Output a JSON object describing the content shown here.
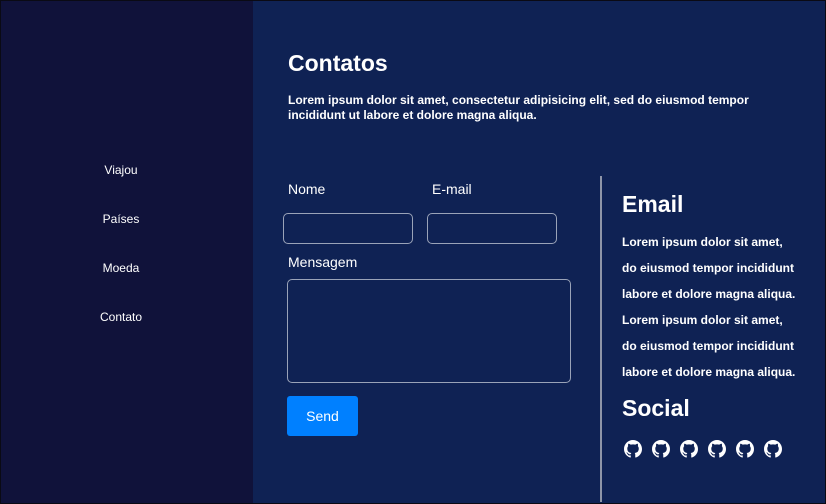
{
  "nav": {
    "items": [
      {
        "label": "Viajou"
      },
      {
        "label": "Países"
      },
      {
        "label": "Moeda"
      },
      {
        "label": "Contato"
      }
    ]
  },
  "header": {
    "title": "Contatos",
    "intro": "Lorem ipsum dolor sit amet, consectetur adipisicing elit, sed do eiusmod tempor incididunt ut labore et dolore magna aliqua."
  },
  "form": {
    "name_label": "Nome",
    "email_label": "E-mail",
    "message_label": "Mensagem",
    "name_value": "",
    "email_value": "",
    "message_value": "",
    "send_label": "Send"
  },
  "contact": {
    "email_heading": "Email",
    "email_lines": [
      "Lorem ipsum dolor sit amet,",
      "do eiusmod tempor incididunt",
      "labore et dolore magna aliqua.",
      "Lorem ipsum dolor sit amet,",
      "do eiusmod tempor incididunt",
      "labore et dolore magna aliqua."
    ],
    "social_heading": "Social",
    "social_icons": [
      "github-icon",
      "github-icon",
      "github-icon",
      "github-icon",
      "github-icon",
      "github-icon"
    ]
  },
  "colors": {
    "sidebar_bg": "#10123a",
    "main_bg": "#0f2254",
    "button_bg": "#0080ff",
    "text": "#ffffff"
  }
}
